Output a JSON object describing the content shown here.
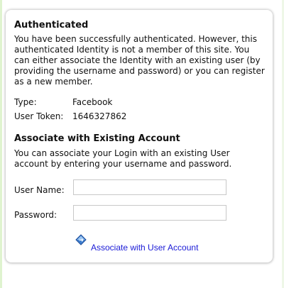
{
  "panel": {
    "title": "Authenticated",
    "description": "You have been successfully authenticated. However, this authenticated Identity is not a member of this site. You can either associate the Identity with an existing user (by providing the username and password) or you can register as a new member.",
    "type_label": "Type:",
    "type_value": "Facebook",
    "token_label": "User Token:",
    "token_value": "1646327862"
  },
  "associate": {
    "title": "Associate with Existing Account",
    "description": "You can associate your Login with an existing User account by entering your username and password.",
    "username_label": "User Name:",
    "username_value": "",
    "password_label": "Password:",
    "password_value": "",
    "button_label": "Associate with User Account",
    "button_icon": "diamond-arrow-icon"
  },
  "colors": {
    "link": "#1a1ad6",
    "accent_edge": "#dff3cf"
  }
}
